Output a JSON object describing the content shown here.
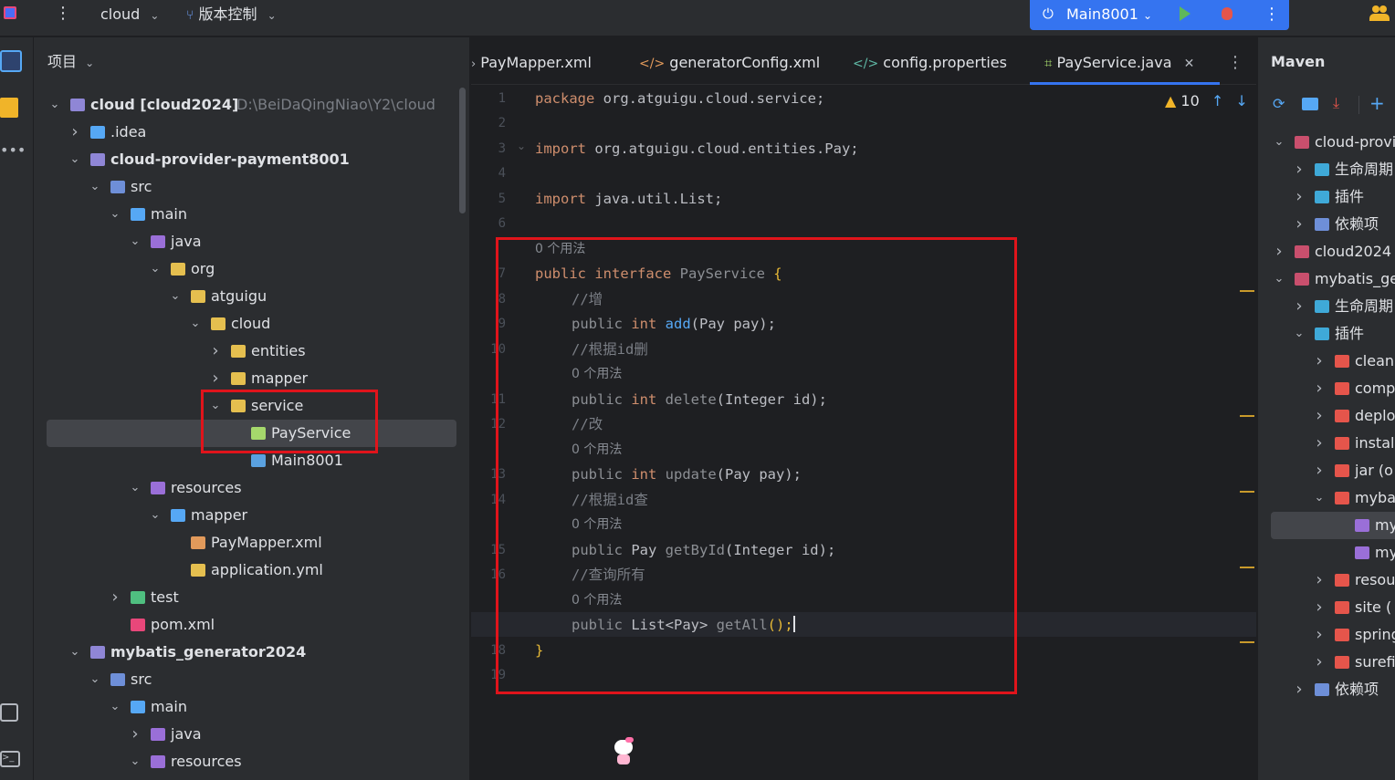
{
  "topbar": {
    "project_name": "cloud",
    "vcs_label": "版本控制",
    "run_config": "Main8001"
  },
  "project_panel": {
    "title": "项目",
    "tree": [
      {
        "label": "cloud [cloud2024]",
        "path": "D:\\BeiDaQingNiao\\Y2\\cloud",
        "level": 0,
        "expanded": true,
        "icon": "module-folder-icon"
      },
      {
        "label": ".idea",
        "level": 1,
        "expanded": false,
        "icon": "folder-icon"
      },
      {
        "label": "cloud-provider-payment8001",
        "level": 1,
        "expanded": true,
        "icon": "module-folder-icon"
      },
      {
        "label": "src",
        "level": 2,
        "expanded": true,
        "icon": "source-folder-icon"
      },
      {
        "label": "main",
        "level": 3,
        "expanded": true,
        "icon": "folder-icon"
      },
      {
        "label": "java",
        "level": 4,
        "expanded": true,
        "icon": "java-folder-icon"
      },
      {
        "label": "org",
        "level": 5,
        "expanded": true,
        "icon": "package-icon"
      },
      {
        "label": "atguigu",
        "level": 6,
        "expanded": true,
        "icon": "package-icon"
      },
      {
        "label": "cloud",
        "level": 7,
        "expanded": true,
        "icon": "package-icon"
      },
      {
        "label": "entities",
        "level": 8,
        "expanded": false,
        "icon": "package-icon"
      },
      {
        "label": "mapper",
        "level": 8,
        "expanded": false,
        "icon": "package-icon"
      },
      {
        "label": "service",
        "level": 8,
        "expanded": true,
        "icon": "package-icon"
      },
      {
        "label": "PayService",
        "level": 9,
        "expanded": null,
        "icon": "interface-icon"
      },
      {
        "label": "Main8001",
        "level": 9,
        "expanded": null,
        "icon": "spring-class-icon"
      },
      {
        "label": "resources",
        "level": 4,
        "expanded": true,
        "icon": "resources-folder-icon"
      },
      {
        "label": "mapper",
        "level": 5,
        "expanded": true,
        "icon": "folder-icon"
      },
      {
        "label": "PayMapper.xml",
        "level": 6,
        "expanded": null,
        "icon": "xml-file-icon"
      },
      {
        "label": "application.yml",
        "level": 6,
        "expanded": null,
        "icon": "yaml-file-icon"
      },
      {
        "label": "test",
        "level": 3,
        "expanded": false,
        "icon": "test-folder-icon"
      },
      {
        "label": "pom.xml",
        "level": 3,
        "expanded": null,
        "icon": "maven-file-icon"
      },
      {
        "label": "mybatis_generator2024",
        "level": 1,
        "expanded": true,
        "icon": "module-folder-icon"
      },
      {
        "label": "src",
        "level": 2,
        "expanded": true,
        "icon": "source-folder-icon"
      },
      {
        "label": "main",
        "level": 3,
        "expanded": true,
        "icon": "folder-icon"
      },
      {
        "label": "java",
        "level": 4,
        "expanded": false,
        "icon": "java-folder-icon"
      },
      {
        "label": "resources",
        "level": 4,
        "expanded": true,
        "icon": "resources-folder-icon"
      }
    ]
  },
  "editor": {
    "tabs": [
      {
        "label": "PayMapper.xml",
        "icon": "xml-file-icon"
      },
      {
        "label": "generatorConfig.xml",
        "icon": "xml-file-icon"
      },
      {
        "label": "config.properties",
        "icon": "properties-file-icon"
      },
      {
        "label": "PayService.java",
        "icon": "interface-icon",
        "active": true
      }
    ],
    "warning_count": "10",
    "usage_hint": "0 个用法",
    "lines": {
      "l1_kw": "package",
      "l1_rest": " org.atguigu.cloud.service;",
      "l3_kw": "import",
      "l3_rest": " org.atguigu.cloud.entities.Pay;",
      "l5_kw": "import",
      "l5_rest": " java.util.List;",
      "l7_kw": "public interface",
      "l7_name": " PayService ",
      "l7_brace": "{",
      "l8_comment": "//增",
      "l9_kw1": "public",
      "l9_kw2": " int",
      "l9_fn": " add",
      "l9_rest": "(Pay pay);",
      "l10_comment": "//根据id删",
      "l11_kw1": "public",
      "l11_kw2": " int",
      "l11_fn": " delete",
      "l11_rest": "(Integer id);",
      "l12_comment": "//改",
      "l13_kw1": "public",
      "l13_kw2": " int",
      "l13_fn": " update",
      "l13_rest": "(Pay pay);",
      "l14_comment": "//根据id查",
      "l15_kw1": "public",
      "l15_type": " Pay",
      "l15_fn": " getById",
      "l15_rest": "(Integer id);",
      "l16_comment": "//查询所有",
      "l17_kw1": "public",
      "l17_type": " List<Pay>",
      "l17_fn": " getAll",
      "l17_rest": "();",
      "l18": "}"
    }
  },
  "maven_panel": {
    "title": "Maven",
    "rows": [
      {
        "label": "cloud-provi",
        "level": 0,
        "expanded": true
      },
      {
        "label": "生命周期",
        "level": 1,
        "expanded": false
      },
      {
        "label": "插件",
        "level": 1,
        "expanded": false
      },
      {
        "label": "依赖项",
        "level": 1,
        "expanded": false
      },
      {
        "label": "cloud2024",
        "level": 0,
        "expanded": false
      },
      {
        "label": "mybatis_ge",
        "level": 0,
        "expanded": true
      },
      {
        "label": "生命周期",
        "level": 1,
        "expanded": false
      },
      {
        "label": "插件",
        "level": 1,
        "expanded": true
      },
      {
        "label": "clean",
        "level": 2,
        "expanded": false
      },
      {
        "label": "comp",
        "level": 2,
        "expanded": false
      },
      {
        "label": "deplo",
        "level": 2,
        "expanded": false
      },
      {
        "label": "instal",
        "level": 2,
        "expanded": false
      },
      {
        "label": "jar (o",
        "level": 2,
        "expanded": false
      },
      {
        "label": "myba",
        "level": 2,
        "expanded": true
      },
      {
        "label": "my",
        "level": 3,
        "expanded": null
      },
      {
        "label": "my",
        "level": 3,
        "expanded": null
      },
      {
        "label": "resou",
        "level": 2,
        "expanded": false
      },
      {
        "label": "site (",
        "level": 2,
        "expanded": false
      },
      {
        "label": "spring",
        "level": 2,
        "expanded": false
      },
      {
        "label": "surefi",
        "level": 2,
        "expanded": false
      },
      {
        "label": "依赖项",
        "level": 1,
        "expanded": false
      }
    ]
  },
  "colors": {
    "accent": "#3574f0",
    "keyword": "#cf8e6d",
    "function": "#56a8f5",
    "highlight_box": "#e0141b"
  }
}
